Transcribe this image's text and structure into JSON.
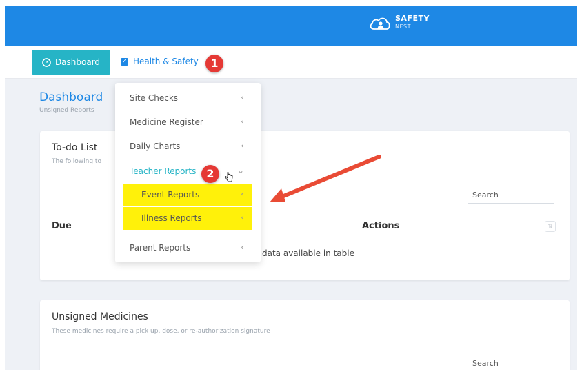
{
  "brand": {
    "name": "SAFETY",
    "sub": "NEST"
  },
  "nav": {
    "dashboard_label": "Dashboard",
    "health_label": "Health & Safety",
    "health_checked": true
  },
  "steps": {
    "one": "1",
    "two": "2"
  },
  "page": {
    "title": "Dashboard",
    "subtitle": "Unsigned Reports"
  },
  "todo": {
    "title": "To-do List",
    "subtitle": "The following to",
    "search_label": "Search",
    "columns": {
      "due": "Due",
      "actions": "Actions"
    },
    "empty_text": "data available in table"
  },
  "medicines": {
    "title": "Unsigned Medicines",
    "subtitle": "These medicines require a pick up, dose, or re-authorization signature",
    "search_label": "Search"
  },
  "menu": {
    "items": [
      {
        "label": "Site Checks",
        "chevron": "‹"
      },
      {
        "label": "Medicine Register",
        "chevron": "‹"
      },
      {
        "label": "Daily Charts",
        "chevron": "‹"
      },
      {
        "label": "Teacher Reports",
        "chevron": "⌄"
      },
      {
        "label": "Event Reports",
        "chevron": "‹"
      },
      {
        "label": "Illness Reports",
        "chevron": "‹"
      },
      {
        "label": "Parent Reports",
        "chevron": "‹"
      }
    ]
  },
  "colors": {
    "topbar": "#1e88e5",
    "accent": "#26b4c6",
    "highlight": "#fff10a",
    "annotation": "#e53935",
    "background": "#eef1f6"
  },
  "icons": [
    "cloud-logo-icon",
    "dashboard-icon",
    "checkbox-icon",
    "chevron-left-icon",
    "chevron-down-icon",
    "hand-cursor-icon",
    "annotation-arrow-icon"
  ]
}
